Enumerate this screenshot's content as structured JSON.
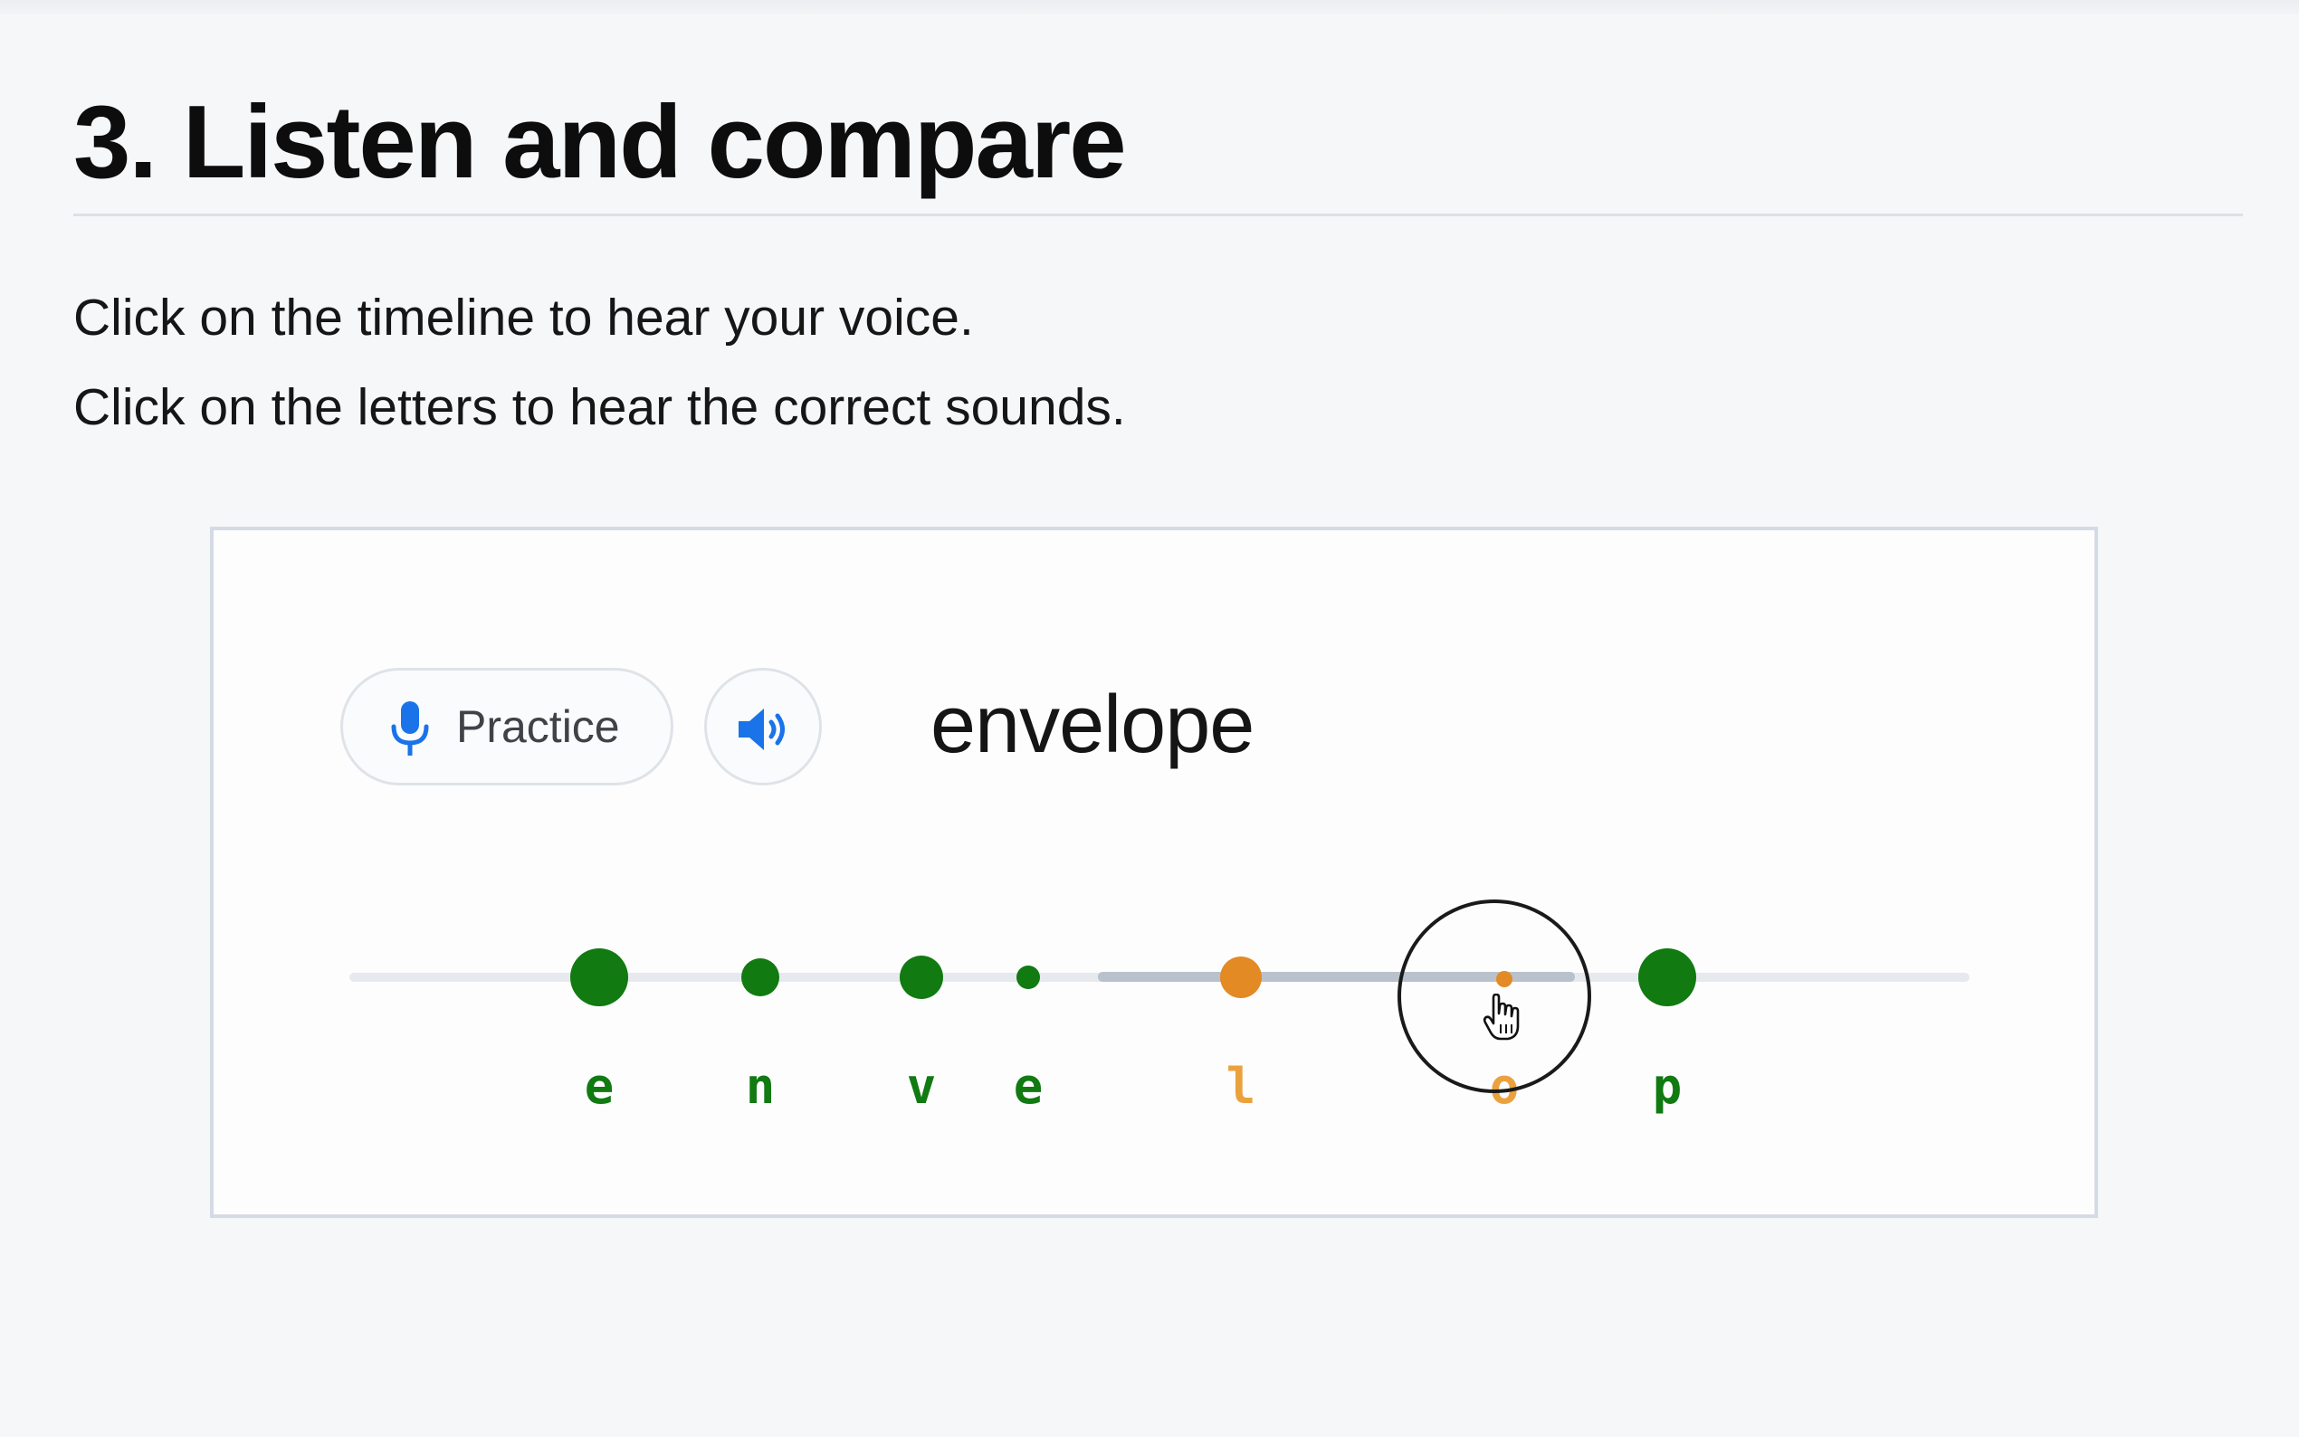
{
  "section": {
    "title": "3. Listen and compare",
    "instructions": [
      "Click on the timeline to hear your voice.",
      "Click on the letters to hear the correct sounds."
    ]
  },
  "widget": {
    "practice_button": {
      "label": "Practice",
      "icon": "microphone-icon"
    },
    "speaker_button": {
      "icon": "speaker-icon"
    },
    "word": "envelope",
    "timeline": {
      "segments": [
        {
          "letter": "e",
          "status": "correct",
          "color": "#117a11"
        },
        {
          "letter": "n",
          "status": "correct",
          "color": "#117a11"
        },
        {
          "letter": "v",
          "status": "correct",
          "color": "#117a11"
        },
        {
          "letter": "e",
          "status": "correct",
          "color": "#117a11"
        },
        {
          "letter": "l",
          "status": "incorrect",
          "color": "#e38a25"
        },
        {
          "letter": "o",
          "status": "incorrect",
          "color": "#e38a25"
        },
        {
          "letter": "p",
          "status": "correct",
          "color": "#117a11"
        }
      ]
    },
    "cursor": "hand-pointer-icon"
  },
  "colors": {
    "correct": "#117a11",
    "incorrect": "#e38a25",
    "accent_blue": "#1a73e8"
  }
}
